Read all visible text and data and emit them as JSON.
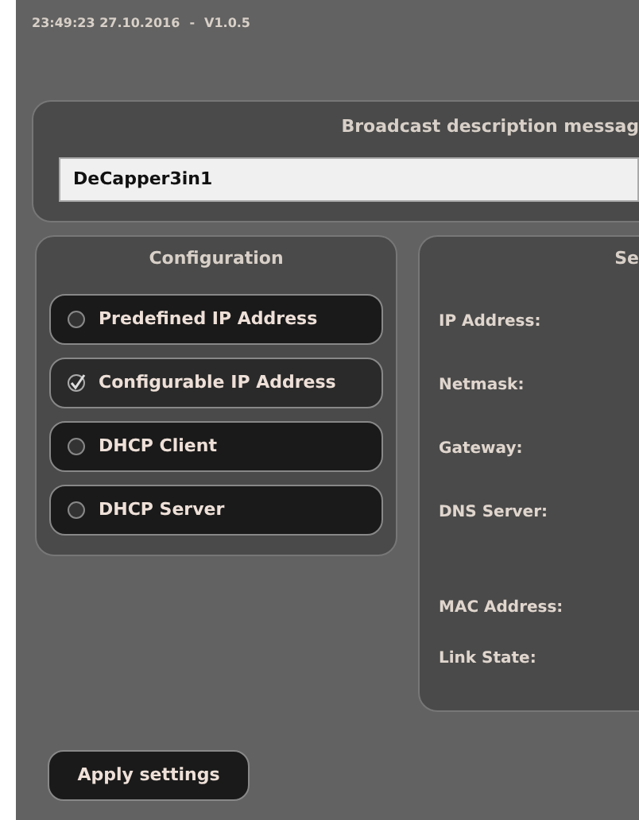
{
  "header": {
    "timestamp": "23:49:23 27.10.2016",
    "separator": "-",
    "version": "V1.0.5"
  },
  "broadcast": {
    "title": "Broadcast description messag",
    "value": "DeCapper3in1"
  },
  "configuration": {
    "title": "Configuration",
    "options": [
      {
        "label": "Predefined IP Address",
        "selected": false
      },
      {
        "label": "Configurable IP Address",
        "selected": true
      },
      {
        "label": "DHCP Client",
        "selected": false
      },
      {
        "label": "DHCP Server",
        "selected": false
      }
    ]
  },
  "settings": {
    "title": "Se",
    "fields": [
      "IP Address:",
      "Netmask:",
      "Gateway:",
      "DNS Server:"
    ],
    "status_fields": [
      "MAC Address:",
      "Link State:"
    ]
  },
  "apply_button": "Apply settings"
}
